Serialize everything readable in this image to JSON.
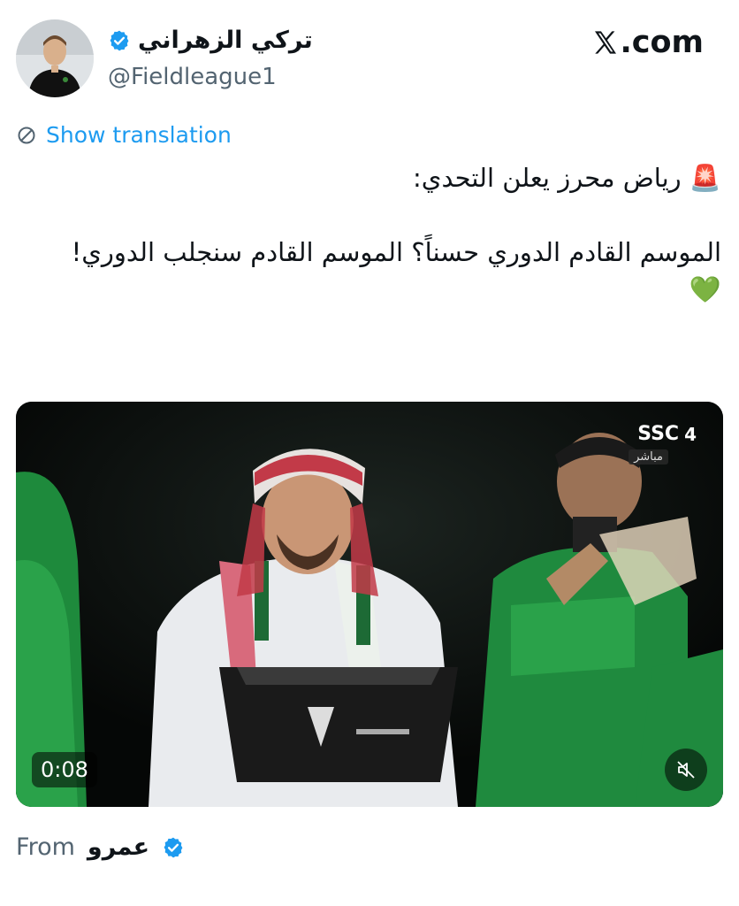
{
  "author": {
    "display_name": "تركي الزهراني",
    "handle": "@Fieldleague1",
    "verified": true,
    "badge_color": "#1d9bf0"
  },
  "brand": {
    "label": ".com",
    "logo_icon": "x-logo-icon"
  },
  "translation": {
    "label": "Show translation",
    "icon": "translate-icon",
    "color": "#1d9bf0"
  },
  "tweet": {
    "line1_emoji": "🚨",
    "line1": "رياض محرز يعلن التحدي:",
    "line2": "الموسم القادم الدوري حسناً؟ الموسم القادم سنجلب الدوري!",
    "line3_emoji": "💚"
  },
  "video": {
    "duration": "0:08",
    "channel_logo": "SSC",
    "channel_number": "4",
    "live_label": "مباشر",
    "mute_icon": "muted-speaker-icon"
  },
  "attribution": {
    "from_label": "From",
    "from_name": "عمرو",
    "verified": true
  }
}
